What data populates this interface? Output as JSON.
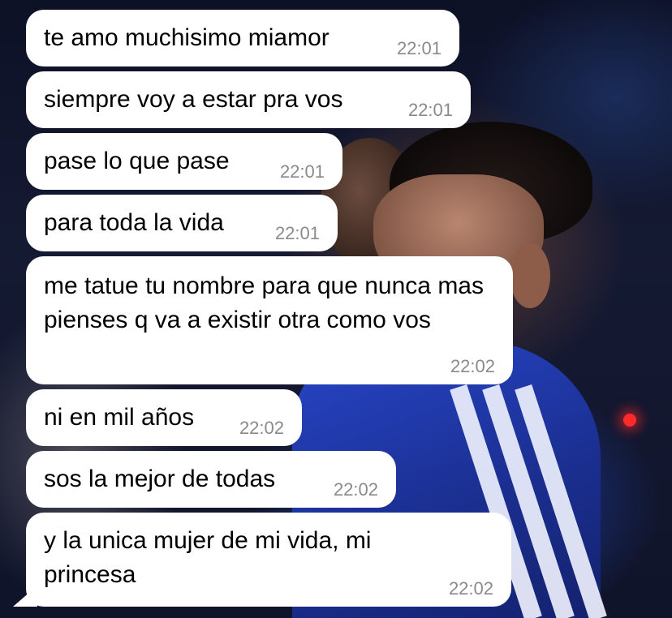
{
  "messages": [
    {
      "text": "te amo muchisimo miamor",
      "time": "22:01"
    },
    {
      "text": "siempre voy a estar pra vos",
      "time": "22:01"
    },
    {
      "text": "pase lo que pase",
      "time": "22:01"
    },
    {
      "text": "para toda la vida",
      "time": "22:01"
    },
    {
      "text": "me tatue tu nombre para que nunca mas pienses q va a existir otra como vos",
      "time": "22:02"
    },
    {
      "text": "ni en mil años",
      "time": "22:02"
    },
    {
      "text": "sos la mejor de todas",
      "time": "22:02"
    },
    {
      "text": "y la unica mujer de mi vida, mi princesa",
      "time": "22:02"
    }
  ],
  "colors": {
    "bubble": "#ffffff",
    "timestamp": "#8a8a8e",
    "text": "#000000"
  }
}
